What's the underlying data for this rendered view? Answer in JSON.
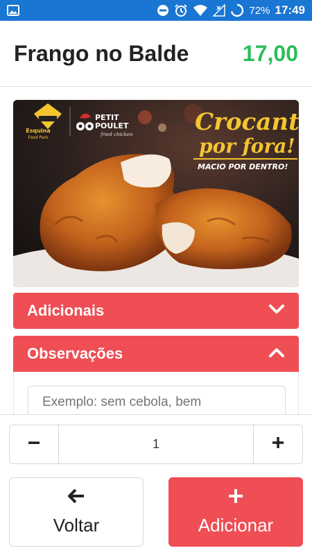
{
  "status_bar": {
    "battery": "72%",
    "time": "17:49",
    "icons": [
      "image-icon",
      "dnd-icon",
      "alarm-icon",
      "wifi-icon",
      "signal-icon",
      "battery-icon"
    ]
  },
  "header": {
    "title": "Frango no Balde",
    "price": "17,00"
  },
  "banner": {
    "brand_1": "Esquina",
    "brand_1_sub": "Food Park",
    "brand_2": "PETIT POULET",
    "brand_2_sub": "fried chicken",
    "headline_1": "Crocante",
    "headline_2": "por fora!",
    "tagline": "MACIO POR DENTRO!"
  },
  "sections": {
    "adicionais": "Adicionais",
    "observacoes": "Observações"
  },
  "observations_input": {
    "placeholder": "Exemplo: sem cebola, bem"
  },
  "quantity": {
    "value": "1",
    "minus": "−",
    "plus": "+"
  },
  "actions": {
    "back_label": "Voltar",
    "add_label": "Adicionar"
  },
  "colors": {
    "status_bar": "#1976d2",
    "accent_red": "#ee4e54",
    "price_green": "#2dbd5c"
  }
}
